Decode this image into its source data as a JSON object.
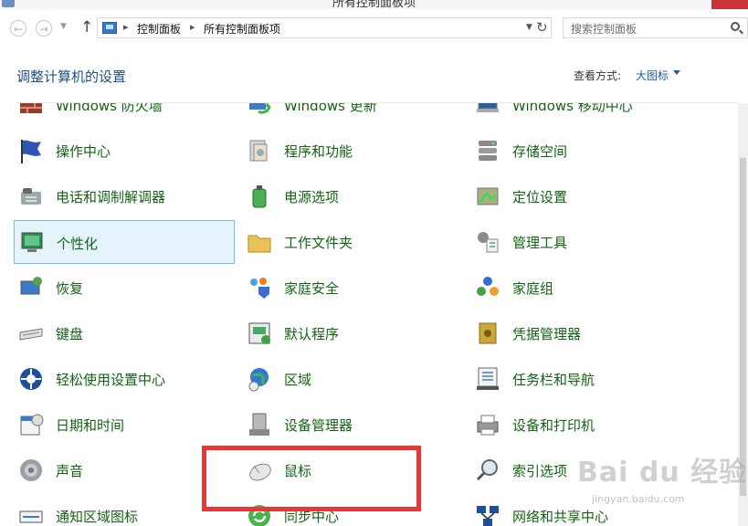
{
  "window": {
    "title": "所有控制面板项"
  },
  "nav": {
    "back_icon": "←",
    "forward_icon": "→",
    "dropdown_icon": "▼",
    "up_icon": "↑",
    "breadcrumb": [
      "控制面板",
      "所有控制面板项"
    ],
    "separator": "▸",
    "refresh_icon": "↻",
    "search_placeholder": "搜索控制面板"
  },
  "header": {
    "title": "调整计算机的设置",
    "view_by_label": "查看方式:",
    "view_by_value": "大图标"
  },
  "items": [
    {
      "label": "Windows 防火墙",
      "icon": "firewall-icon"
    },
    {
      "label": "Windows 更新",
      "icon": "windows-update-icon"
    },
    {
      "label": "Windows 移动中心",
      "icon": "mobility-center-icon"
    },
    {
      "label": "操作中心",
      "icon": "action-center-flag-icon"
    },
    {
      "label": "程序和功能",
      "icon": "programs-features-icon"
    },
    {
      "label": "存储空间",
      "icon": "storage-spaces-icon"
    },
    {
      "label": "电话和调制解调器",
      "icon": "phone-modem-icon"
    },
    {
      "label": "电源选项",
      "icon": "power-options-icon"
    },
    {
      "label": "定位设置",
      "icon": "location-settings-icon"
    },
    {
      "label": "个性化",
      "icon": "personalization-icon",
      "selected": true
    },
    {
      "label": "工作文件夹",
      "icon": "work-folders-icon"
    },
    {
      "label": "管理工具",
      "icon": "administrative-tools-icon"
    },
    {
      "label": "恢复",
      "icon": "recovery-icon"
    },
    {
      "label": "家庭安全",
      "icon": "family-safety-icon"
    },
    {
      "label": "家庭组",
      "icon": "homegroup-icon"
    },
    {
      "label": "键盘",
      "icon": "keyboard-icon"
    },
    {
      "label": "默认程序",
      "icon": "default-programs-icon"
    },
    {
      "label": "凭据管理器",
      "icon": "credential-manager-icon"
    },
    {
      "label": "轻松使用设置中心",
      "icon": "ease-of-access-icon"
    },
    {
      "label": "区域",
      "icon": "region-globe-icon"
    },
    {
      "label": "任务栏和导航",
      "icon": "taskbar-navigation-icon"
    },
    {
      "label": "日期和时间",
      "icon": "date-time-icon"
    },
    {
      "label": "设备管理器",
      "icon": "device-manager-icon"
    },
    {
      "label": "设备和打印机",
      "icon": "devices-printers-icon"
    },
    {
      "label": "声音",
      "icon": "sound-speaker-icon"
    },
    {
      "label": "鼠标",
      "icon": "mouse-icon"
    },
    {
      "label": "索引选项",
      "icon": "indexing-options-icon"
    },
    {
      "label": "通知区域图标",
      "icon": "notification-area-icon"
    },
    {
      "label": "同步中心",
      "icon": "sync-center-icon"
    },
    {
      "label": "网络和共享中心",
      "icon": "network-sharing-icon"
    }
  ],
  "watermark": {
    "text": "Bai du 经验",
    "sub": "jingyan.baidu.com"
  },
  "colors": {
    "accent": "#1e4e8c",
    "item_text": "#136313",
    "selection_bg": "#e5f3fb",
    "selection_border": "#70c0e7",
    "highlight_box": "#e63838"
  }
}
